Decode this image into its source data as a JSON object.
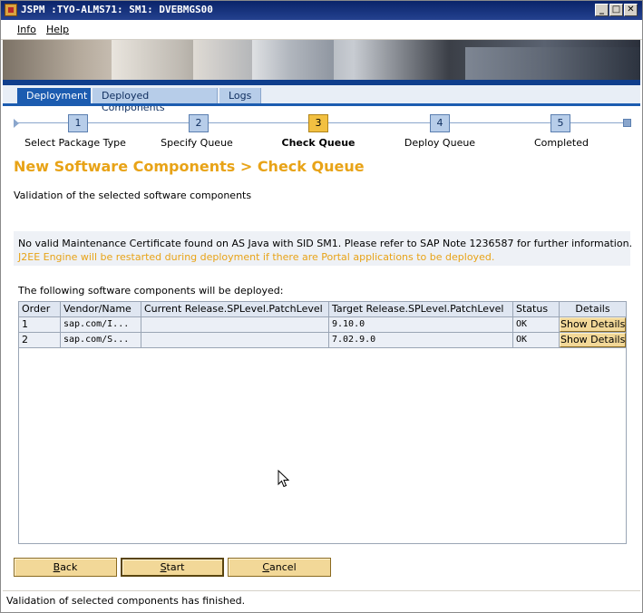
{
  "window": {
    "title": "JSPM :TYO-ALMS71: SM1: DVEBMGS00",
    "controls": [
      "minimize-icon",
      "maximize-icon",
      "close-icon"
    ]
  },
  "menu": {
    "items": [
      {
        "label": "Info"
      },
      {
        "label": "Help"
      }
    ]
  },
  "tabs": [
    {
      "label": "Deployment",
      "active": true
    },
    {
      "label": "Deployed Components",
      "active": false
    },
    {
      "label": "Logs",
      "active": false
    }
  ],
  "roadmap": {
    "steps": [
      {
        "number": "1",
        "label": "Select Package Type"
      },
      {
        "number": "2",
        "label": "Specify Queue"
      },
      {
        "number": "3",
        "label": "Check Queue",
        "current": true
      },
      {
        "number": "4",
        "label": "Deploy Queue"
      },
      {
        "number": "5",
        "label": "Completed"
      }
    ]
  },
  "page": {
    "title": "New Software Components > Check Queue",
    "subtitle": "Validation of the selected software components"
  },
  "messages": {
    "warning": "No valid Maintenance Certificate found on AS Java with SID SM1. Please refer to SAP Note 1236587 for further information.",
    "info": "J2EE Engine will be restarted during deployment if there are Portal applications to be deployed."
  },
  "table": {
    "caption": "The following software components will be deployed:",
    "columns": [
      "Order",
      "Vendor/Name",
      "Current Release.SPLevel.PatchLevel",
      "Target Release.SPLevel.PatchLevel",
      "Status",
      "Details"
    ],
    "rows": [
      {
        "order": "1",
        "vendor": "sap.com/I...",
        "current": "",
        "target": "9.10.0",
        "status": "OK",
        "details": "Show Details"
      },
      {
        "order": "2",
        "vendor": "sap.com/S...",
        "current": "",
        "target": "7.02.9.0",
        "status": "OK",
        "details": "Show Details"
      }
    ]
  },
  "buttons": {
    "back": {
      "first": "B",
      "rest": "ack"
    },
    "start": {
      "first": "S",
      "rest": "tart"
    },
    "cancel": {
      "first": "C",
      "rest": "ancel"
    }
  },
  "status_bar": {
    "text": "Validation of selected components has finished."
  },
  "colors": {
    "accent_orange": "#e8a317",
    "tab_blue": "#1c5cb0",
    "button_yellow": "#f2d898",
    "title_bar": "#0a246a"
  }
}
